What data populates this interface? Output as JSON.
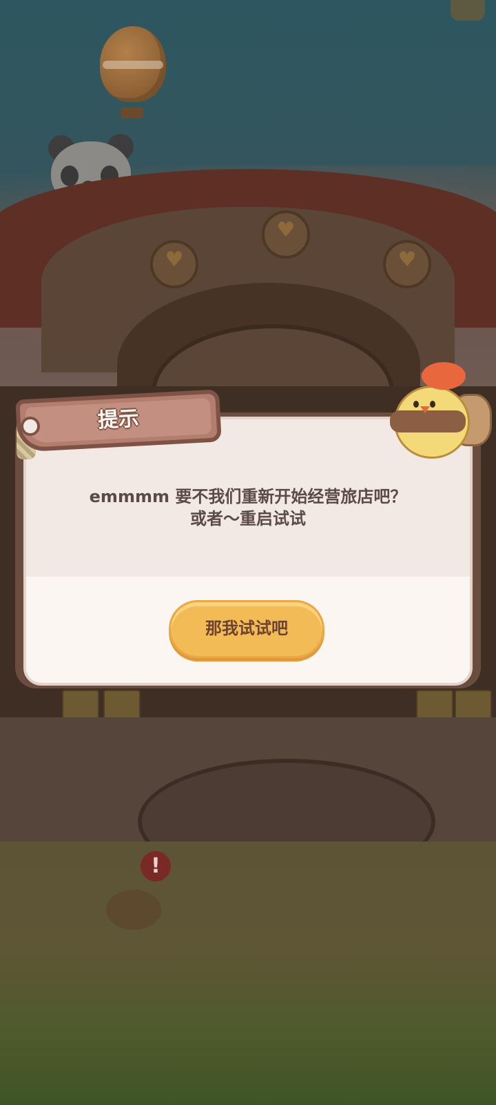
{
  "dialog": {
    "title": "提示",
    "message_line1": "emmmm 要不我们重新开始经营旅店吧？",
    "message_line2": "或者～重启试试",
    "confirm_label": "那我试试吧"
  },
  "scene": {
    "alert_glyph": "!"
  },
  "colors": {
    "dialog_bg": "#f2e9e4",
    "dialog_frame": "#6b4d40",
    "title_tag": "#c38f80",
    "button": "#f3bb56",
    "button_text": "#6b4330"
  }
}
